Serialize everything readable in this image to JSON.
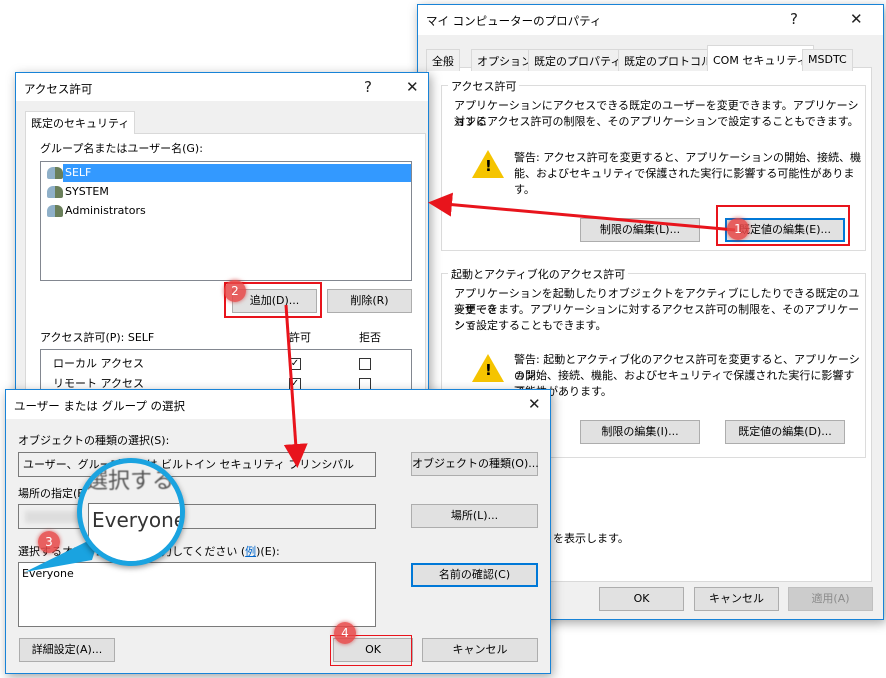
{
  "props_window": {
    "title": "マイ コンピューターのプロパティ",
    "help": "?",
    "close": "✕",
    "tabs": [
      "全般",
      "オプション",
      "既定のプロパティ",
      "既定のプロトコル",
      "COM セキュリティ",
      "MSDTC"
    ],
    "active_tab": "COM セキュリティ",
    "access": {
      "legend": "アクセス許可",
      "desc1": "アプリケーションにアクセスできる既定のユーザーを変更できます。アプリケーションに",
      "desc2": "対するアクセス許可の制限を、そのアプリケーションで設定することもできます。",
      "warn1": "警告: アクセス許可を変更すると、アプリケーションの開始、接続、機",
      "warn2": "能、およびセキュリティで保護された実行に影響する可能性があります。",
      "edit_limits": "制限の編集(L)...",
      "edit_default": "既定値の編集(E)..."
    },
    "launch": {
      "legend": "起動とアクティブ化のアクセス許可",
      "desc1": "アプリケーションを起動したりオブジェクトをアクティブにしたりできる既定のユーザーを",
      "desc2": "変更できます。アプリケーションに対するアクセス許可の制限を、そのアプリケーショ",
      "desc3": "ンで設定することもできます。",
      "warn1": "警告: 起動とアクティブ化のアクセス許可を変更すると、アプリケーション",
      "warn2": "の開始、接続、機能、およびセキュリティで保護された実行に影響する",
      "warn3": "可能性があります。",
      "edit_limits": "制限の編集(I)...",
      "edit_default": "既定値の編集(D)..."
    },
    "footer_text": "を表示します。",
    "ok": "OK",
    "cancel": "キャンセル",
    "apply": "適用(A)"
  },
  "access_window": {
    "title": "アクセス許可",
    "help": "?",
    "close": "✕",
    "tab": "既定のセキュリティ",
    "group_label": "グループ名またはユーザー名(G):",
    "users": [
      {
        "name": "SELF",
        "selected": true
      },
      {
        "name": "SYSTEM"
      },
      {
        "name": "Administrators"
      }
    ],
    "add": "追加(D)...",
    "remove": "削除(R)",
    "perm_label": "アクセス許可(P): SELF",
    "allow": "許可",
    "deny": "拒否",
    "perms": [
      {
        "name": "ローカル アクセス",
        "allow": true,
        "deny": false
      },
      {
        "name": "リモート アクセス",
        "allow": true,
        "deny": false
      }
    ]
  },
  "select_window": {
    "title": "ユーザー または グループ の選択",
    "close": "✕",
    "type_label": "オブジェクトの種類の選択(S):",
    "type_value": "ユーザー、グループ または ビルトイン セキュリティ プリンシパル",
    "type_btn": "オブジェクトの種類(O)...",
    "loc_label": "場所の指定(F):",
    "loc_btn": "場所(L)...",
    "names_label_a": "選択するオブジェクト名を入力してください (",
    "names_link": "例",
    "names_label_b": ")(E):",
    "names_value": "Everyone",
    "check_btn": "名前の確認(C)",
    "advanced": "詳細設定(A)...",
    "ok": "OK",
    "cancel": "キャンセル"
  },
  "magnifier": {
    "top_text": "選択する",
    "text": "Everyone"
  },
  "badges": [
    "1",
    "2",
    "3",
    "4"
  ],
  "colors": {
    "accent": "#0078d7",
    "annotation": "#e8141c",
    "magnifier": "#1aa3e0"
  }
}
